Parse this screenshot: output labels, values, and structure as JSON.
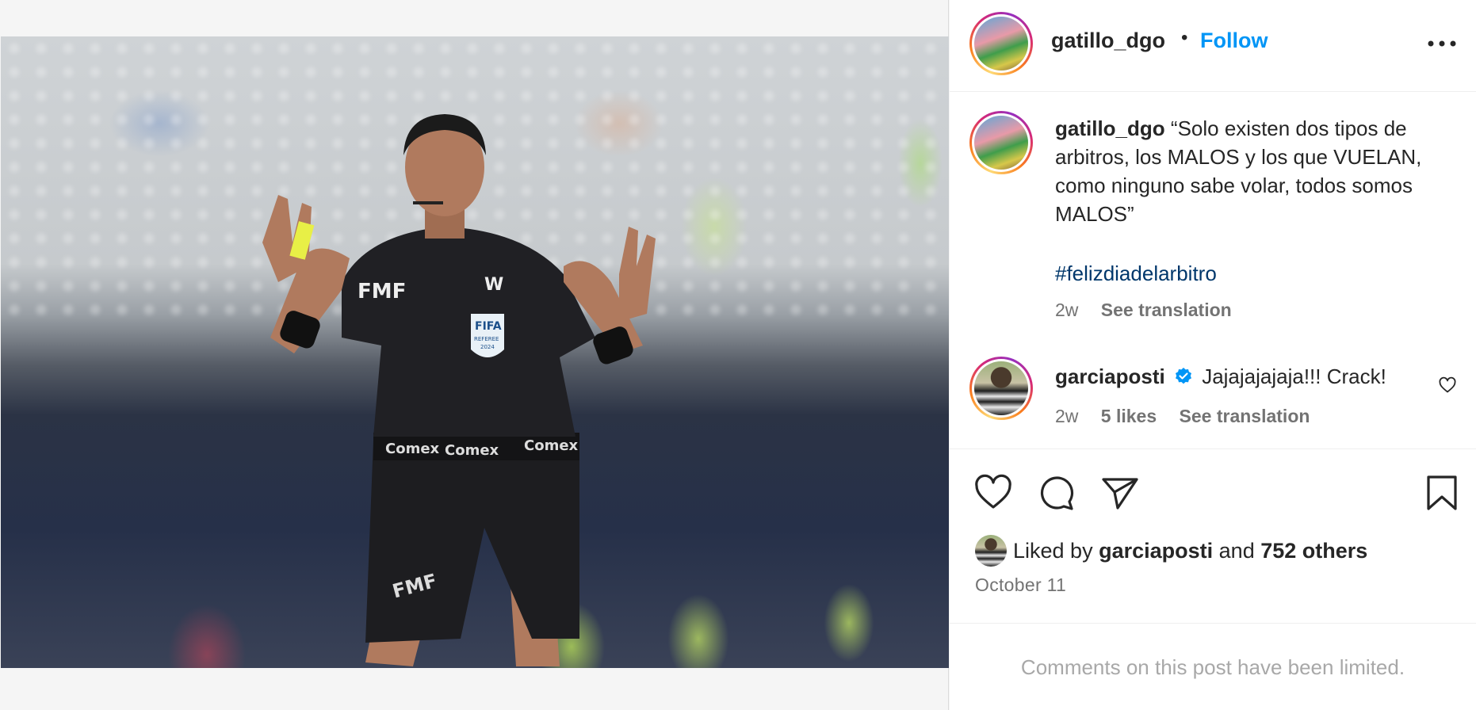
{
  "post": {
    "author": "gatillo_dgo",
    "follow_label": "Follow",
    "separator": "•",
    "caption_username": "gatillo_dgo",
    "caption": "“Solo existen dos tipos de arbitros, los MALOS y los que VUELAN, como ninguno sabe volar, todos somos MALOS”",
    "hashtag": "#felizdiadelarbitro",
    "caption_age": "2w",
    "caption_translate": "See translation",
    "photo_text": {
      "chest_logo": "FMF",
      "badge": "FIFA",
      "badge_sub": "REFEREE",
      "badge_year": "2024",
      "sleeve_logo": "W",
      "belt": [
        "Comex",
        "Comex",
        "Comex"
      ],
      "shorts_logo": "FMF"
    }
  },
  "comment": {
    "username": "garciaposti",
    "verified": true,
    "text": "Jajajajajaja!!! Crack!",
    "age": "2w",
    "likes": "5 likes",
    "translate": "See translation"
  },
  "likes_summary": {
    "prefix": "Liked by",
    "user": "garciaposti",
    "conj": "and",
    "others": "752 others"
  },
  "date": "October 11",
  "comments_limited": "Comments on this post have been limited.",
  "icons": {
    "more": "more-options-icon",
    "like": "heart-icon",
    "comment": "comment-icon",
    "share": "share-icon",
    "save": "bookmark-icon",
    "verified": "verified-badge-icon"
  },
  "colors": {
    "accent": "#0095f6",
    "hashtag": "#00376b",
    "muted": "#737373",
    "verified": "#0095f6"
  }
}
